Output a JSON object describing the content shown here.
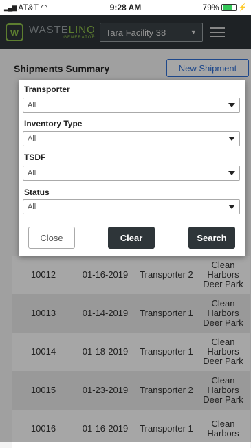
{
  "status_bar": {
    "carrier": "AT&T",
    "time": "9:28 AM",
    "battery": "79%",
    "battery_level": 0.79
  },
  "header": {
    "logo_letter": "W",
    "brand_prefix": "WASTE",
    "brand_suffix": "LINQ",
    "brand_sub": "GENERATOR",
    "facility": "Tara Facility 38",
    "accent": "#8fc24a",
    "bg": "#2e3539"
  },
  "page": {
    "title": "Shipments Summary",
    "new_shipment": "New Shipment"
  },
  "filter": {
    "fields": [
      {
        "label": "Transporter",
        "value": "All"
      },
      {
        "label": "Inventory Type",
        "value": "All"
      },
      {
        "label": "TSDF",
        "value": "All"
      },
      {
        "label": "Status",
        "value": "All"
      }
    ],
    "close": "Close",
    "clear": "Clear",
    "search": "Search"
  },
  "rows": [
    {
      "id": "10012",
      "date": "01-16-2019",
      "transporter": "Transporter 2",
      "tsdf": "Clean Harbors Deer Park"
    },
    {
      "id": "10013",
      "date": "01-14-2019",
      "transporter": "Transporter 1",
      "tsdf": "Clean Harbors Deer Park"
    },
    {
      "id": "10014",
      "date": "01-18-2019",
      "transporter": "Transporter 1",
      "tsdf": "Clean Harbors Deer Park"
    },
    {
      "id": "10015",
      "date": "01-23-2019",
      "transporter": "Transporter 2",
      "tsdf": "Clean Harbors Deer Park"
    },
    {
      "id": "10016",
      "date": "01-16-2019",
      "transporter": "Transporter 1",
      "tsdf": "Clean Harbors"
    }
  ]
}
